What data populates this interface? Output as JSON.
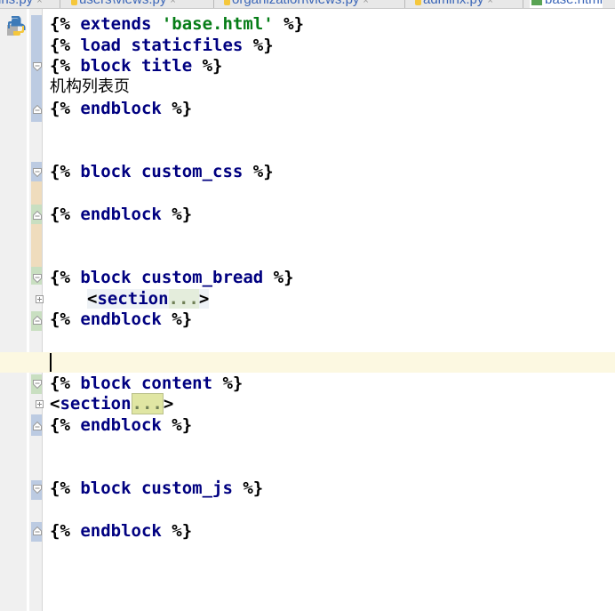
{
  "tabs": [
    {
      "label": "ins.py",
      "kind": "py"
    },
    {
      "label": "users\\views.py",
      "kind": "py"
    },
    {
      "label": "organization\\views.py",
      "kind": "py"
    },
    {
      "label": "adminx.py",
      "kind": "py"
    },
    {
      "label": "base.html",
      "kind": "html"
    }
  ],
  "tab_close_glyph": "×",
  "code": {
    "l1": {
      "open": "{% ",
      "kw": "extends",
      "str": "'base.html'",
      "close": " %}"
    },
    "l2": {
      "open": "{% ",
      "kw": "load staticfiles",
      "close": " %}"
    },
    "l3": {
      "open": "{% ",
      "kw": "block title",
      "close": " %}"
    },
    "l4": {
      "text": "机构列表页"
    },
    "l5": {
      "open": "{% ",
      "kw": "endblock",
      "close": " %}"
    },
    "l6": {
      "open": "{% ",
      "kw": "block custom_css",
      "close": " %}"
    },
    "l7": {
      "open": "{% ",
      "kw": "endblock",
      "close": " %}"
    },
    "l8": {
      "open": "{% ",
      "kw": "block custom_bread",
      "close": " %}"
    },
    "l9": {
      "lt": "<",
      "tag": "section",
      "folded": "...",
      "gt": ">"
    },
    "l10": {
      "open": "{% ",
      "kw": "endblock",
      "close": " %}"
    },
    "l11": {
      "open": "{% ",
      "kw": "block content",
      "close": " %}"
    },
    "l12": {
      "lt": "<",
      "tag": "section",
      "folded": "...",
      "gt": ">"
    },
    "l13": {
      "open": "{% ",
      "kw": "endblock",
      "close": " %}"
    },
    "l14": {
      "open": "{% ",
      "kw": "block custom_js",
      "close": " %}"
    },
    "l15": {
      "open": "{% ",
      "kw": "endblock",
      "close": " %}"
    }
  },
  "colors": {
    "keyword": "#000080",
    "string": "#067d17",
    "caret_line": "#fcf8e1",
    "gutter_change": "#bccbe2"
  }
}
